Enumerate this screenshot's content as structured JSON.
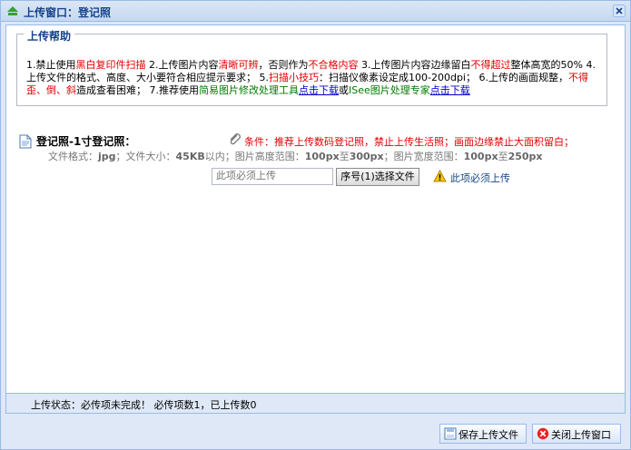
{
  "window": {
    "title": "上传窗口：登记照"
  },
  "help": {
    "legend": "上传帮助",
    "segments": [
      {
        "text": "1.禁止使用",
        "style": "plain"
      },
      {
        "text": "黑白复印件扫描",
        "style": "red"
      },
      {
        "text": " 2.上传图片内容",
        "style": "plain"
      },
      {
        "text": "清晰可辨",
        "style": "red"
      },
      {
        "text": "，否则作为",
        "style": "plain"
      },
      {
        "text": "不合格内容",
        "style": "red"
      },
      {
        "text": " 3.上传图片内容边缘留白",
        "style": "plain"
      },
      {
        "text": "不得超过",
        "style": "red"
      },
      {
        "text": "整体高宽的50% 4.上传文件的格式、高度、大小要符合相应提示要求； 5.",
        "style": "plain"
      },
      {
        "text": "扫描小技巧",
        "style": "red"
      },
      {
        "text": "：扫描仪像素设定成100-200dpi； 6.上传的画面规整，",
        "style": "plain"
      },
      {
        "text": "不得歪、倒、斜",
        "style": "red"
      },
      {
        "text": "造成查看困难； 7.推荐使用",
        "style": "plain"
      },
      {
        "text": "简易图片修改处理工具",
        "style": "green"
      },
      {
        "text": "点击下载",
        "style": "link"
      },
      {
        "text": "或",
        "style": "plain"
      },
      {
        "text": "ISee图片处理专家",
        "style": "green"
      },
      {
        "text": "点击下载",
        "style": "link"
      }
    ]
  },
  "item": {
    "title": "登记照-1寸登记照：",
    "condition": "条件：推荐上传数码登记照，禁止上传生活照；画面边缘禁止大面积留白；",
    "spec": {
      "format_label": "文件格式：",
      "format": "jpg",
      "size_label": "；文件大小：",
      "size": "45KB",
      "size_suffix": "以内；图片高度范围：",
      "height_min": "100px",
      "to1": "至",
      "height_max": "300px",
      "width_label": "；图片宽度范围：",
      "width_min": "100px",
      "to2": "至",
      "width_max": "250px"
    },
    "input_placeholder": "此项必须上传",
    "choose_label": "序号(1)选择文件",
    "warning": "此项必须上传"
  },
  "status": {
    "text": "上传状态：必传项未完成！ 必传项数1，已上传数0"
  },
  "buttons": {
    "save": "保存上传文件",
    "close": "关闭上传窗口"
  },
  "colors": {
    "title_blue": "#15428b",
    "border_blue": "#99bbe8",
    "bg": "#dfe8f6",
    "red": "#e00000",
    "green": "#007a00"
  }
}
